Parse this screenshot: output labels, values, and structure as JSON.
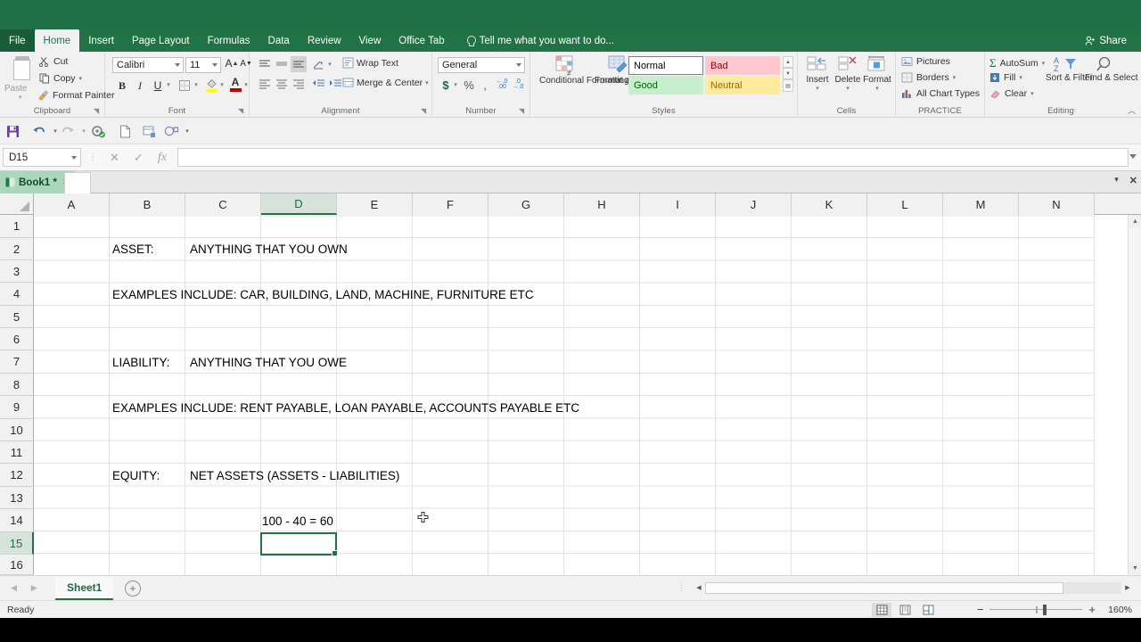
{
  "titlebar": {
    "share_label": "Share"
  },
  "ribbon_tabs": [
    {
      "label": "File",
      "active": false
    },
    {
      "label": "Home",
      "active": true
    },
    {
      "label": "Insert",
      "active": false
    },
    {
      "label": "Page Layout",
      "active": false
    },
    {
      "label": "Formulas",
      "active": false
    },
    {
      "label": "Data",
      "active": false
    },
    {
      "label": "Review",
      "active": false
    },
    {
      "label": "View",
      "active": false
    },
    {
      "label": "Office Tab",
      "active": false
    }
  ],
  "tellme": {
    "text": "Tell me what you want to do..."
  },
  "ribbon": {
    "clipboard": {
      "group_label": "Clipboard",
      "paste_label": "Paste",
      "cut_label": "Cut",
      "copy_label": "Copy",
      "format_painter_label": "Format Painter"
    },
    "font": {
      "group_label": "Font",
      "font_name": "Calibri",
      "font_size": "11",
      "grow_font": "A",
      "shrink_font": "A",
      "bold": "B",
      "italic": "I",
      "underline": "U",
      "borders": "borders-icon",
      "fill_color": "fill-color-icon",
      "font_color": "A"
    },
    "alignment": {
      "group_label": "Alignment",
      "wrap_text_label": "Wrap Text",
      "merge_center_label": "Merge & Center"
    },
    "number": {
      "group_label": "Number",
      "format": "General",
      "currency": "$",
      "percent": "%",
      "comma": ",",
      "increase_decimal": ".00",
      "decrease_decimal": ".0"
    },
    "styles": {
      "group_label": "Styles",
      "conditional_formatting_label": "Conditional Formatting",
      "format_as_table_label": "Format as Table",
      "cell_styles": [
        {
          "name": "Normal",
          "bg": "#ffffff",
          "fg": "#000000",
          "border": "#7f7f7f"
        },
        {
          "name": "Bad",
          "bg": "#ffc7ce",
          "fg": "#9c0006",
          "border": "#ffc7ce"
        },
        {
          "name": "Good",
          "bg": "#c6efce",
          "fg": "#006100",
          "border": "#c6efce"
        },
        {
          "name": "Neutral",
          "bg": "#ffeb9c",
          "fg": "#9c6500",
          "border": "#ffeb9c"
        }
      ]
    },
    "cells": {
      "group_label": "Cells",
      "insert_label": "Insert",
      "delete_label": "Delete",
      "format_label": "Format"
    },
    "practice": {
      "group_label": "PRACTICE",
      "pictures_label": "Pictures",
      "borders_label": "Borders",
      "all_chart_types_label": "All Chart Types"
    },
    "editing": {
      "group_label": "Editing",
      "autosum_label": "AutoSum",
      "fill_label": "Fill",
      "clear_label": "Clear",
      "sort_filter_label": "Sort & Filter",
      "find_select_label": "Find & Select"
    }
  },
  "qat": {
    "items": [
      {
        "name": "save-icon"
      },
      {
        "name": "undo-icon"
      },
      {
        "name": "redo-icon"
      },
      {
        "name": "kutools-icon"
      },
      {
        "name": "new-file-icon"
      },
      {
        "name": "export-icon"
      },
      {
        "name": "shapes-icon"
      }
    ]
  },
  "formula_bar": {
    "name_box": "D15",
    "cancel_icon": "close-icon",
    "enter_icon": "check-icon",
    "function_icon": "fx",
    "formula_value": ""
  },
  "workbook_tabs": {
    "tabs": [
      {
        "label": "Book1 *",
        "active": true
      }
    ]
  },
  "grid": {
    "columns": [
      "A",
      "B",
      "C",
      "D",
      "E",
      "F",
      "G",
      "H",
      "I",
      "J",
      "K",
      "L",
      "M",
      "N"
    ],
    "selected_column": "D",
    "rows": [
      "1",
      "2",
      "3",
      "4",
      "5",
      "6",
      "7",
      "8",
      "9",
      "10",
      "11",
      "12",
      "13",
      "14",
      "15",
      "16"
    ],
    "selected_row": "15",
    "active_cell": "D15",
    "cells": [
      {
        "ref": "B2",
        "row": 2,
        "col": "B",
        "text": "ASSET:"
      },
      {
        "ref": "C2",
        "row": 2,
        "col": "C",
        "text": "ANYTHING THAT YOU OWN"
      },
      {
        "ref": "B4",
        "row": 4,
        "col": "B",
        "text": "EXAMPLES INCLUDE: CAR, BUILDING, LAND, MACHINE, FURNITURE ETC"
      },
      {
        "ref": "B7",
        "row": 7,
        "col": "B",
        "text": "LIABILITY:"
      },
      {
        "ref": "C7",
        "row": 7,
        "col": "C",
        "text": "ANYTHING THAT YOU OWE"
      },
      {
        "ref": "B9",
        "row": 9,
        "col": "B",
        "text": "EXAMPLES INCLUDE: RENT PAYABLE, LOAN PAYABLE, ACCOUNTS PAYABLE ETC"
      },
      {
        "ref": "B12",
        "row": 12,
        "col": "B",
        "text": "EQUITY:"
      },
      {
        "ref": "C12",
        "row": 12,
        "col": "C",
        "text": "NET ASSETS (ASSETS - LIABILITIES)"
      },
      {
        "ref": "D14",
        "row": 14,
        "col": "D",
        "text": "100 - 40 = 60"
      }
    ]
  },
  "sheet_bar": {
    "sheets": [
      {
        "label": "Sheet1",
        "active": true
      }
    ],
    "add_sheet_label": "+"
  },
  "status_bar": {
    "status": "Ready",
    "views": [
      "normal-view-icon",
      "page-layout-icon",
      "page-break-icon"
    ],
    "active_view": "normal-view-icon",
    "zoom_out": "−",
    "zoom_in": "+",
    "zoom_level": "160%"
  },
  "colors": {
    "ribbon_green": "#217346",
    "title_green": "#1f7046",
    "selection_green": "#217346",
    "tab_teal": "#a9d6bd"
  }
}
